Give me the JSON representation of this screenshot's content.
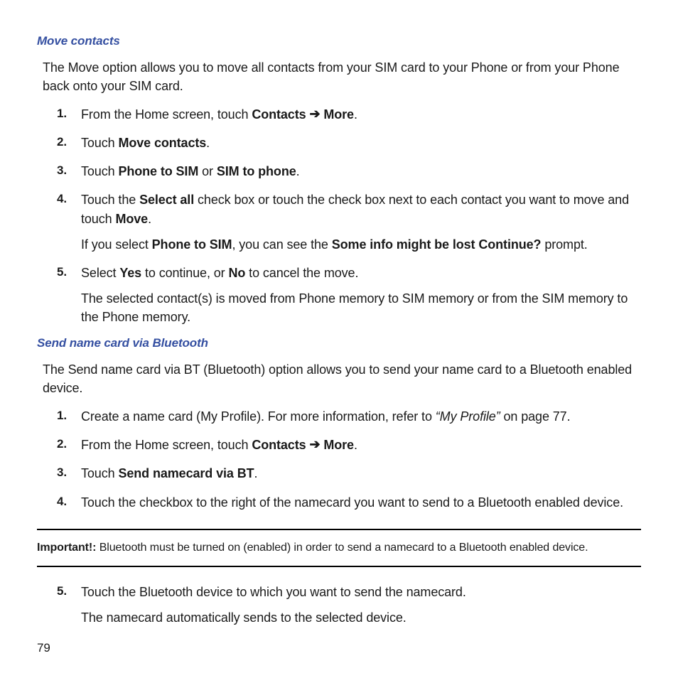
{
  "page_number": "79",
  "sec1": {
    "heading": "Move contacts",
    "intro": "The Move option allows you to move all contacts from your SIM card to your Phone or from your Phone back onto your SIM card.",
    "steps": {
      "s1": {
        "pre": "From the Home screen, touch ",
        "contacts": "Contacts",
        "arrow": "➔",
        "more": "More",
        "post": "."
      },
      "s2": {
        "pre": "Touch ",
        "bold": "Move contacts",
        "post": "."
      },
      "s3": {
        "pre": "Touch ",
        "b1": "Phone to SIM",
        "mid": " or ",
        "b2": "SIM to phone",
        "post": "."
      },
      "s4": {
        "pre": "Touch the ",
        "b1": "Select all",
        "mid1": " check box or touch the check box next to each contact you want to move and touch ",
        "b2": "Move",
        "post1": ".",
        "cont_pre": "If you select ",
        "b3": "Phone to SIM",
        "cont_mid": ", you can see the ",
        "b4": "Some info might be lost Continue?",
        "cont_post": " prompt."
      },
      "s5": {
        "pre": "Select ",
        "b1": "Yes",
        "mid": " to continue, or ",
        "b2": "No",
        "post": " to cancel the move.",
        "cont": "The selected contact(s) is moved from Phone memory to SIM memory or from the SIM memory to the Phone memory."
      }
    }
  },
  "sec2": {
    "heading": "Send name card via Bluetooth",
    "intro": "The Send name card via BT (Bluetooth) option allows you to send your name card to a Bluetooth enabled device.",
    "steps": {
      "s1": {
        "pre": "Create a name card (My Profile). For more information, refer to ",
        "ref": "“My Profile”",
        "post": "  on page 77."
      },
      "s2": {
        "pre": "From the Home screen, touch ",
        "contacts": "Contacts",
        "arrow": "➔",
        "more": "More",
        "post": "."
      },
      "s3": {
        "pre": "Touch ",
        "bold": "Send namecard via BT",
        "post": "."
      },
      "s4": {
        "text": "Touch the checkbox to the right of the namecard you want to send to a Bluetooth enabled device."
      },
      "s5": {
        "text": "Touch the Bluetooth device to which you want to send the namecard.",
        "cont": "The namecard automatically sends to the selected device."
      }
    },
    "important": {
      "label": "Important!:",
      "text": " Bluetooth must be turned on (enabled) in order to send a namecard to a Bluetooth enabled device."
    }
  }
}
